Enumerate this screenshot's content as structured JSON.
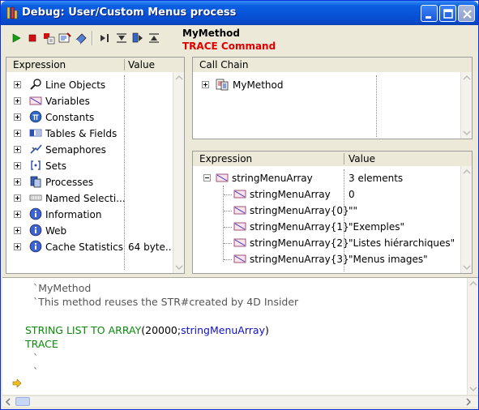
{
  "window": {
    "title": "Debug: User/Custom Menus process"
  },
  "header": {
    "method_name": "MyMethod",
    "trace_command": "TRACE Command"
  },
  "expression_panel": {
    "col_expression": "Expression",
    "col_value": "Value",
    "items": [
      {
        "label": "Line Objects",
        "value": "",
        "icon": "magnifier-icon"
      },
      {
        "label": "Variables",
        "value": "",
        "icon": "variable-icon"
      },
      {
        "label": "Constants",
        "value": "",
        "icon": "pi-icon"
      },
      {
        "label": "Tables & Fields",
        "value": "",
        "icon": "table-icon"
      },
      {
        "label": "Semaphores",
        "value": "",
        "icon": "semaphore-icon"
      },
      {
        "label": "Sets",
        "value": "",
        "icon": "set-icon"
      },
      {
        "label": "Processes",
        "value": "",
        "icon": "process-icon"
      },
      {
        "label": "Named Selecti...",
        "value": "",
        "icon": "named-selection-icon"
      },
      {
        "label": "Information",
        "value": "",
        "icon": "info-icon"
      },
      {
        "label": "Web",
        "value": "",
        "icon": "info-icon"
      },
      {
        "label": "Cache Statistics",
        "value": "64 byte..",
        "icon": "info-icon"
      }
    ]
  },
  "call_chain_panel": {
    "title": "Call Chain",
    "items": [
      {
        "label": "MyMethod"
      }
    ]
  },
  "custom_watch_panel": {
    "col_expression": "Expression",
    "col_value": "Value",
    "root": {
      "label": "stringMenuArray",
      "value": "3 elements"
    },
    "children": [
      {
        "label": "stringMenuArray",
        "value": "0"
      },
      {
        "label": "stringMenuArray{0}",
        "value": "\"\""
      },
      {
        "label": "stringMenuArray{1}",
        "value": "\"Exemples\""
      },
      {
        "label": "stringMenuArray{2}",
        "value": "\"Listes hiérarchiques\""
      },
      {
        "label": "stringMenuArray{3}",
        "value": "\"Menus images\""
      }
    ]
  },
  "source": {
    "comment1": "`MyMethod",
    "comment2": "`This method reuses the STR#created by 4D Insider",
    "line3_cmd": "STRING LIST TO ARRAY",
    "line3_open": "(20000;",
    "line3_var": "stringMenuArray",
    "line3_close": ")",
    "line4_cmd": "TRACE",
    "comment5": "`",
    "comment6": "`"
  },
  "colors": {
    "keyword": "#0a8a0a",
    "comment": "#555555",
    "variable": "#1010c0",
    "trace_red": "#e00000"
  }
}
